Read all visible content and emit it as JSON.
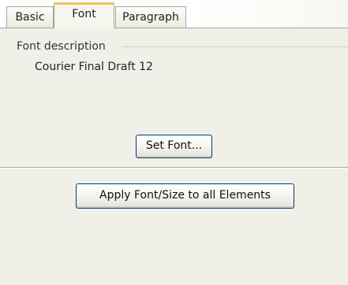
{
  "tabs": [
    {
      "label": "Basic",
      "active": false
    },
    {
      "label": "Font",
      "active": true
    },
    {
      "label": "Paragraph",
      "active": false
    }
  ],
  "font_group": {
    "label": "Font description",
    "value": "Courier Final Draft 12"
  },
  "buttons": {
    "set_font": "Set Font...",
    "apply_all": "Apply Font/Size to all Elements"
  },
  "colors": {
    "panel_background": "#f1f0e8",
    "active_tab_accent": "#f2c15e",
    "button_border": "#003c74"
  }
}
